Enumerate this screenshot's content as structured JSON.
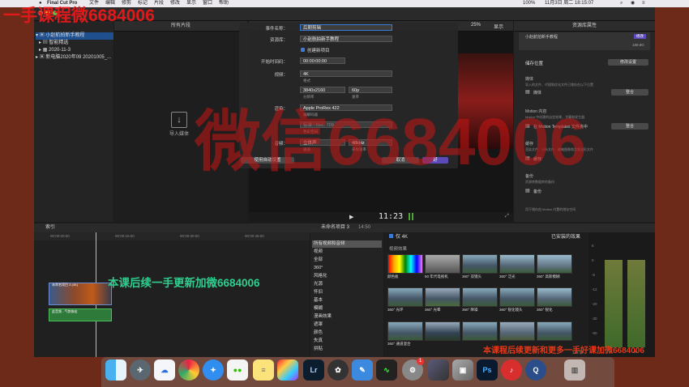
{
  "menubar": {
    "app_name": "Final Cut Pro",
    "items": [
      "文件",
      "编辑",
      "修剪",
      "标记",
      "片段",
      "修改",
      "显示",
      "窗口",
      "帮助"
    ],
    "battery": "100%",
    "date": "11月3日 周二  18:15:07"
  },
  "watermark_top": "一手课程微6684006",
  "watermark_center": "微信6684006",
  "watermark_timeline": "本课后续一手更新加微6684006",
  "watermark_bottom": "本课程后续更新和更多一手好课加微6684006",
  "library": {
    "rows": [
      "小赵航拍新手教程",
      "智能精选",
      "2020-11-3",
      "新电脑2020年09 20201005_..."
    ]
  },
  "browser": {
    "header": "所有片段",
    "import_label": "导入媒体"
  },
  "viewer": {
    "zoom": "25%",
    "display": "显示",
    "timecode": "11:23"
  },
  "dialog": {
    "event_label": "事件名称：",
    "event_value": "后期剪辑",
    "library_label": "资源库：",
    "library_value": "小赵航拍新手教程",
    "create_project": "创建新项目",
    "start_label": "开始时间码：",
    "start_value": "00:00:00:00",
    "video_label": "视频：",
    "video_format": "4K",
    "format_sub": "格式",
    "resolution": "3840x2160",
    "resolution_sub": "分辨率",
    "rate": "60p",
    "rate_sub": "速率",
    "render_label": "渲染：",
    "codec": "Apple ProRes 422",
    "codec_sub": "编解码器",
    "colorspace": "标准 - Rec. 709",
    "colorspace_sub": "色彩空间",
    "audio_label": "音频：",
    "channels": "立体声",
    "channels_sub": "通道",
    "samplerate": "48kHz",
    "samplerate_sub": "采样速率",
    "auto_settings": "使用自动设置",
    "cancel": "取消",
    "ok": "好"
  },
  "inspector": {
    "header": "资源库属性",
    "library_name": "小赵航拍新手教程",
    "modify": "修改",
    "size": "189.8G",
    "storage_title": "储存位置",
    "storage_btn": "修改设置",
    "consolidate_title": "媒体",
    "consolidate_desc": "导入的文件、代理和优化文件已储存在以下位置",
    "consolidate_label": "媒体",
    "consolidate_btn": "整合",
    "motion_title": "Motion 内容",
    "motion_desc": "Motion 中创建的自定效果、字幕和发生器",
    "motion_label": "在 Motion Templates 文件夹中",
    "motion_btn": "整合",
    "cache_title": "缓存",
    "cache_desc": "渲染文件、分析文件、缩略图像和音频波形文件",
    "cache_label": "缓存",
    "backup_title": "备份",
    "backup_desc": "资源库数据库的备份",
    "backup_label": "备份",
    "footer": "用于储存由 Motion 内置的储存空间"
  },
  "timeline": {
    "index": "索引",
    "project": "未命名项目 3",
    "duration": "14:50",
    "effects": "效果",
    "only4k": "仅 4K",
    "installed": "已安装的效果",
    "ruler": [
      "00:00:00:00",
      "00:00:15:00",
      "00:00:30:00",
      "00:00:45:00"
    ],
    "clip_video": "未命名项目 3 (4K)",
    "clip_audio": "此音频 - 气势恢宏",
    "count": "143 项"
  },
  "effects": {
    "categories": [
      "所有视频和音频",
      "视频",
      "全部",
      "360°",
      "风格化",
      "光源",
      "怀旧",
      "基本",
      "模糊",
      "漫画效果",
      "遮罩",
      "颜色",
      "失真",
      "拼贴"
    ],
    "header": "视频效果",
    "items": [
      "颜色板",
      "50 年代电视机",
      "360° 双镜头",
      "360° 泛光",
      "360° 高斯模糊",
      "360° 光环",
      "360° 光晕",
      "360° 降噪",
      "360° 锐化镜头",
      "360° 锐化",
      "360° 通道混合",
      "",
      "",
      "",
      ""
    ]
  },
  "meters": {
    "labels": [
      "6",
      "0",
      "-6",
      "-12",
      "-20",
      "-30",
      "-50"
    ],
    "left": "L",
    "right": "R"
  },
  "dock": {
    "icons": [
      "finder-icon",
      "launchpad-icon",
      "baidu-netdisk-icon",
      "chrome-icon",
      "safari-icon",
      "wechat-icon",
      "notes-icon",
      "final-cut-icon",
      "lightroom-icon",
      "davinci-icon",
      "pencil-icon",
      "activity-icon",
      "settings-icon",
      "imovie-icon",
      "preview-icon",
      "photoshop-icon",
      "netease-music-icon",
      "quicktime-icon",
      "trash-icon"
    ],
    "lr": "Lr",
    "ps": "Ps",
    "badge": "1"
  }
}
